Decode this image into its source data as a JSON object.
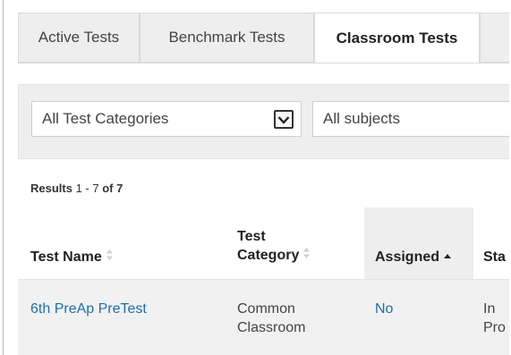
{
  "tabs": [
    {
      "label": "Active Tests",
      "active": false
    },
    {
      "label": "Benchmark Tests",
      "active": false
    },
    {
      "label": "Classroom Tests",
      "active": true
    }
  ],
  "filters": {
    "category": "All Test Categories",
    "subject": "All subjects"
  },
  "results": {
    "prefix": "Results",
    "range": "1 - 7",
    "of_word": "of",
    "total": "7"
  },
  "table": {
    "columns": {
      "test_name": "Test Name",
      "test_category_line1": "Test",
      "test_category_line2": "Category",
      "assigned": "Assigned",
      "status": "Sta"
    },
    "rows": [
      {
        "test_name": "6th PreAp PreTest",
        "category_line1": "Common",
        "category_line2": "Classroom",
        "assigned": "No",
        "status_line1": "In",
        "status_line2": "Pro"
      }
    ]
  },
  "colors": {
    "link": "#1f6fa8",
    "tab_inactive_bg": "#eeeeee",
    "panel_bg": "#eeeeee"
  }
}
